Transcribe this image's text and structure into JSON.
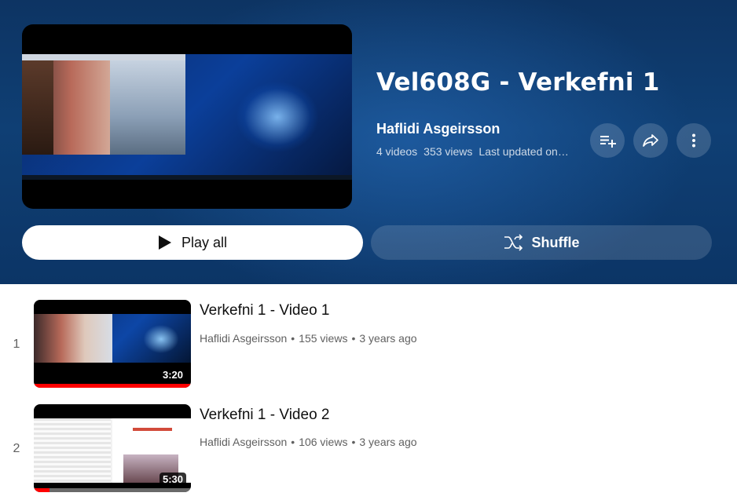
{
  "playlist": {
    "title": "Vel608G - Verkefni 1",
    "channel": "Haflidi Asgeirsson",
    "video_count": "4 videos",
    "views": "353 views",
    "last_updated": "Last updated on…"
  },
  "actions": {
    "play_all_label": "Play all",
    "shuffle_label": "Shuffle"
  },
  "videos": [
    {
      "index": "1",
      "title": "Verkefni 1 - Video 1",
      "channel": "Haflidi Asgeirsson",
      "views": "155 views",
      "age": "3 years ago",
      "duration": "3:20",
      "watched_fraction": 1.0
    },
    {
      "index": "2",
      "title": "Verkefni 1 - Video 2",
      "channel": "Haflidi Asgeirsson",
      "views": "106 views",
      "age": "3 years ago",
      "duration": "5:30",
      "watched_fraction": 0.1
    }
  ],
  "icons": {
    "save": "add-to-playlist-icon",
    "share": "share-icon",
    "more": "more-vertical-icon",
    "play": "play-icon",
    "shuffle": "shuffle-icon"
  },
  "colors": {
    "header_bg": "#0f3f74",
    "progress": "#ff0000"
  }
}
